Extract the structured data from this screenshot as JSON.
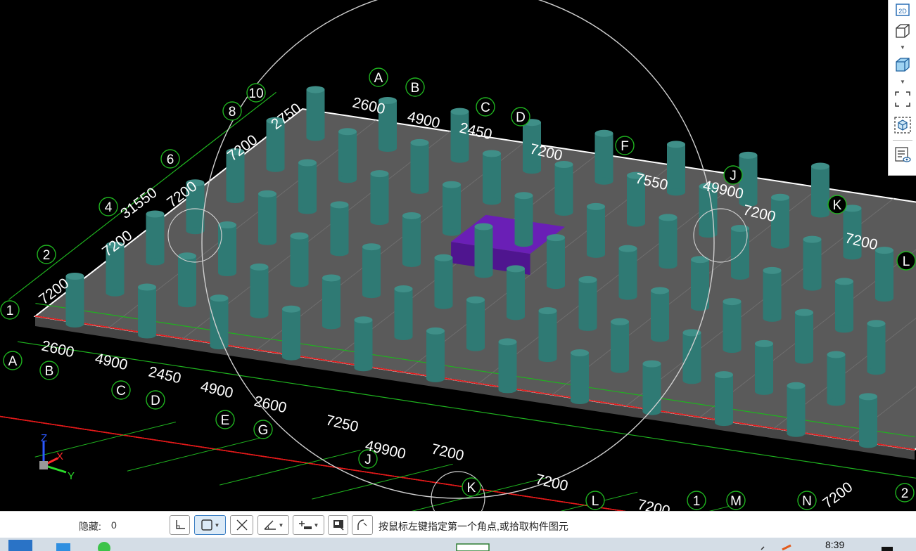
{
  "viewport": {
    "axis_labels": {
      "grid_numbers": [
        "10",
        "8",
        "6",
        "4",
        "2",
        "1",
        "1",
        "2"
      ],
      "grid_letters_top": [
        "A",
        "B",
        "C",
        "D",
        "F",
        "J",
        "K",
        "L"
      ],
      "grid_letters_bottom": [
        "A",
        "B",
        "C",
        "D",
        "E",
        "G",
        "J",
        "K",
        "L",
        "M",
        "N"
      ]
    },
    "dimensions": {
      "top": [
        "2600",
        "4900",
        "2450",
        "7200",
        "7550",
        "49900",
        "7200",
        "7200"
      ],
      "left": [
        "2750",
        "7200",
        "7200",
        "31550",
        "7200",
        "7200"
      ],
      "bottom": [
        "2600",
        "4900",
        "2450",
        "4900",
        "2600",
        "7250",
        "49900",
        "7200",
        "7200",
        "7200",
        "7200"
      ]
    },
    "axis_gizmo": {
      "z": "Z",
      "x": "X",
      "y": "Y"
    },
    "colors": {
      "background": "#000000",
      "slab_top": "#5a5a5a",
      "slab_side": "#454545",
      "column": "#2f7a74",
      "column_top": "#3f8f88",
      "block": "#6a1fb6",
      "grid_green": "#1fb31f",
      "grid_red": "#e21a1a",
      "orbit_ring": "#cfcfcf"
    }
  },
  "view_toolbar": {
    "buttons": [
      {
        "name": "2d-view",
        "icon": "2d-view-icon",
        "text": "2D"
      },
      {
        "name": "3d-box-view",
        "icon": "cube-outline-icon"
      },
      {
        "name": "3d-shaded-view",
        "icon": "cube-shaded-icon"
      },
      {
        "name": "zoom-extents",
        "icon": "dashed-frame-icon"
      },
      {
        "name": "view-selection",
        "icon": "cube-select-icon"
      },
      {
        "name": "display-settings",
        "icon": "list-eye-icon"
      }
    ]
  },
  "status_bar": {
    "hidden_label": "隐藏:",
    "hidden_count": "0",
    "prompt": "按鼠标左键指定第一个角点,或拾取构件图元",
    "tools": [
      {
        "name": "ortho",
        "icon": "ortho-icon"
      },
      {
        "name": "object-snap",
        "icon": "snap-frame-icon",
        "active": true,
        "dropdown": true
      },
      {
        "name": "intersection",
        "icon": "cross-icon"
      },
      {
        "name": "angle",
        "icon": "angle-icon",
        "dropdown": true
      },
      {
        "name": "offset-input",
        "icon": "plus-bar-icon",
        "dropdown": true
      },
      {
        "name": "dynamic-input",
        "icon": "dynamic-input-icon"
      },
      {
        "name": "arc-mode",
        "icon": "arc-icon"
      }
    ]
  },
  "taskbar": {
    "clock": "8:39"
  }
}
